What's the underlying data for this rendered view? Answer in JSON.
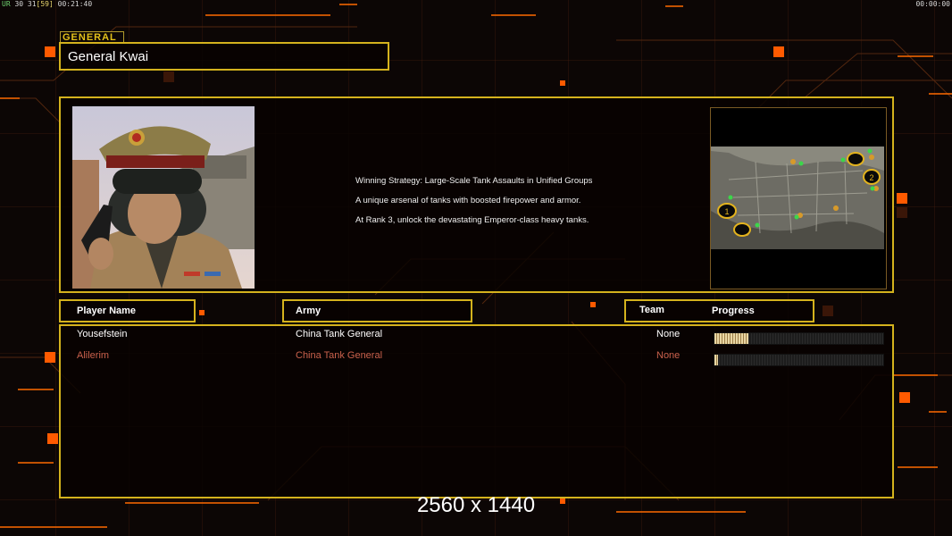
{
  "hud": {
    "left_prefix": "UR ",
    "left_nums": "30 31",
    "left_bracket": "[59]",
    "left_time": " 00:21:40",
    "right_time": "00:00:00"
  },
  "general": {
    "tag": "GENERAL",
    "name": "General Kwai",
    "description": [
      "Winning Strategy: Large-Scale Tank Assaults in Unified Groups",
      "A unique arsenal of tanks with boosted firepower and armor.",
      "At Rank 3, unlock the devastating Emperor-class heavy tanks."
    ],
    "map_markers": [
      "1",
      "2"
    ]
  },
  "table": {
    "headers": {
      "player_name": "Player Name",
      "army": "Army",
      "team": "Team",
      "progress": "Progress"
    },
    "rows": [
      {
        "name": "Yousefstein",
        "army": "China Tank General",
        "team": "None",
        "progress": 0.2,
        "color": "#ffffff"
      },
      {
        "name": "Alilerim",
        "army": "China Tank General",
        "team": "None",
        "progress": 0.02,
        "color": "#c9614c"
      }
    ]
  },
  "resolution_label": "2560 x 1440",
  "colors": {
    "gold": "#d4b21d",
    "accent_orange": "#ff6a00",
    "background": "#0c0605"
  }
}
